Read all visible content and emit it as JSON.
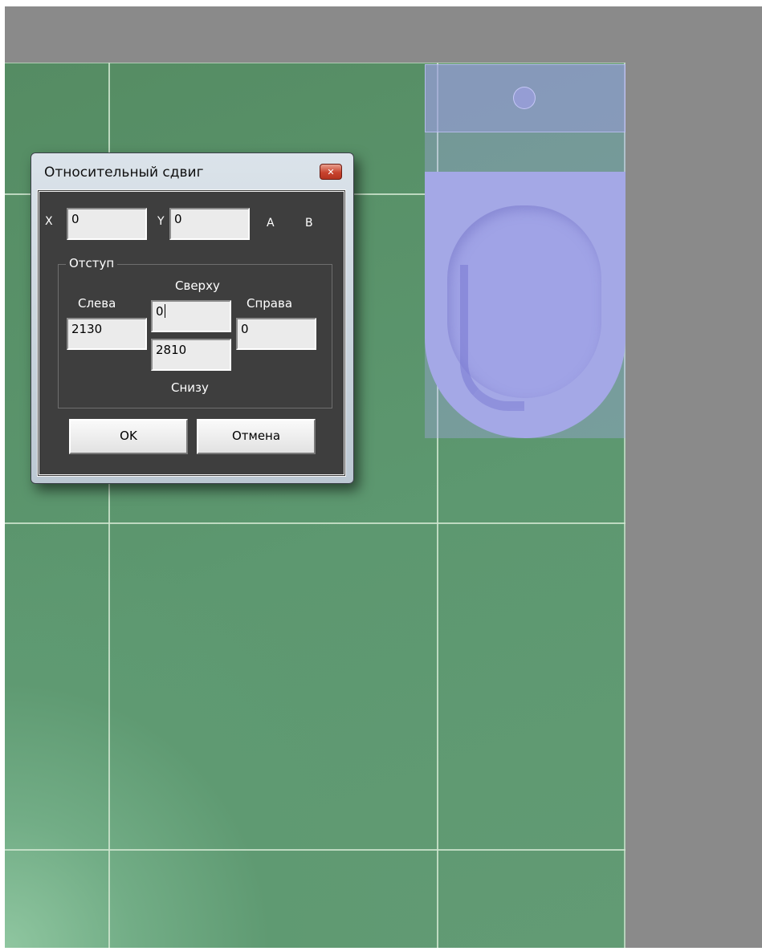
{
  "dialog": {
    "title": "Относительный сдвиг",
    "close_icon": "close-icon",
    "x_label": "X",
    "x_value": "0",
    "y_label": "Y",
    "y_value": "0",
    "a_label": "A",
    "b_label": "B",
    "group": {
      "title": "Отступ",
      "top_label": "Сверху",
      "top_value": "0",
      "left_label": "Слева",
      "left_value": "2130",
      "right_label": "Справа",
      "right_value": "0",
      "bottom_value": "2810",
      "bottom_label": "Снизу"
    },
    "ok_label": "OK",
    "cancel_label": "Отмена"
  },
  "colors": {
    "floor": "#5d9870",
    "background": "#8a8a8a",
    "fixture": "#a4a8e6",
    "dialog_client": "#3e3e3e",
    "close_button": "#c8432e"
  }
}
